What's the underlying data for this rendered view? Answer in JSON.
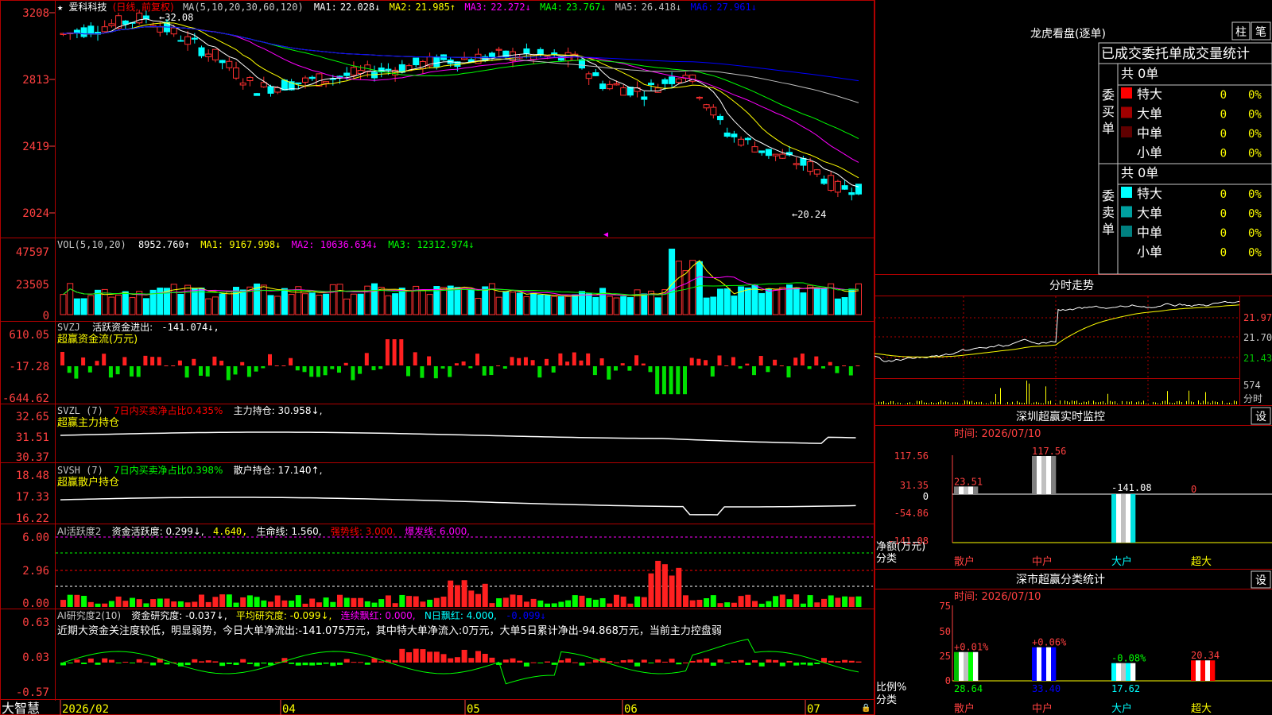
{
  "chart_header": {
    "star": "★",
    "stock_name": "爱科科技",
    "period": "(日线, 前复权)",
    "ma_params": "MA(5,10,20,30,60,120)",
    "ma_values": [
      {
        "label": "MA1:",
        "value": "22.028↓",
        "color": "#ffffff"
      },
      {
        "label": "MA2:",
        "value": "21.985↑",
        "color": "#ffff00"
      },
      {
        "label": "MA3:",
        "value": "22.272↓",
        "color": "#ff00ff"
      },
      {
        "label": "MA4:",
        "value": "23.767↓",
        "color": "#00ff00"
      },
      {
        "label": "MA5:",
        "value": "26.418↓",
        "color": "#c0c0c0"
      },
      {
        "label": "MA6:",
        "value": "27.961↓",
        "color": "#0000ff"
      }
    ],
    "high_label": "32.08",
    "low_label": "20.24"
  },
  "price_axis": [
    "3208",
    "2813",
    "2419",
    "2024"
  ],
  "vol_panel": {
    "title": "VOL(5,10,20)",
    "value": "8952.760↑",
    "ma1": "MA1: 9167.998↓",
    "ma2": "MA2: 10636.634↓",
    "ma3": "MA3: 12312.974↓",
    "axis": [
      "47597",
      "23505",
      "0"
    ]
  },
  "svzj_panel": {
    "title": "SVZJ",
    "label": "活跃资金进出:",
    "value": "-141.074↓,",
    "subtitle": "超赢资金流(万元)",
    "axis": [
      "610.05",
      "-17.28",
      "-644.62"
    ]
  },
  "svzl_panel": {
    "title": "SVZL (7)",
    "ratio": "7日内买卖净占比0.435%",
    "holding": "主力持仓: 30.958↓,",
    "subtitle": "超赢主力持仓",
    "axis": [
      "32.65",
      "31.51",
      "30.37"
    ]
  },
  "svsh_panel": {
    "title": "SVSH (7)",
    "ratio": "7日内买卖净占比0.398%",
    "holding": "散户持仓: 17.140↑,",
    "subtitle": "超赢散户持仓",
    "axis": [
      "18.48",
      "17.33",
      "16.22"
    ]
  },
  "ai_active_panel": {
    "title": "AI活跃度2",
    "label": "资金活跃度: 0.299↓,",
    "v2": "4.640,",
    "life": "生命线: 1.560,",
    "strong": "强势线: 3.000,",
    "burst": "爆发线: 6.000,",
    "axis": [
      "6.00",
      "2.96",
      "0.00"
    ]
  },
  "ai_research_panel": {
    "title": "AI研究度2(10)",
    "label": "资金研究度: -0.037↓,",
    "avg": "平均研究度: -0.099↓,",
    "streak": "连续飘红: 0.000,",
    "nday": "N日飘红: 4.000,",
    "last": "-0.099↓",
    "comment": "近期大资金关注度较低，明显弱势，今日大单净流出:-141.075万元，其中特大单净流入:0万元，大单5日累计净出-94.868万元，当前主力控盘弱",
    "axis": [
      "0.63",
      "0.03",
      "-0.57"
    ]
  },
  "bottom_bar": {
    "brand": "大智慧",
    "dates": [
      "2026/02",
      "04",
      "05",
      "06",
      "07"
    ]
  },
  "longhu": {
    "title": "龙虎看盘(逐单)",
    "tab_bar": "柱",
    "tab_pen": "笔",
    "header": "已成交委托单成交量统计",
    "buy_side": "委买单",
    "sell_side": "委卖单",
    "buy_total": "共 0单",
    "sell_total": "共 0单",
    "buy_rows": [
      {
        "label": "特大",
        "v": "0",
        "p": "0%",
        "color": "#ff0000"
      },
      {
        "label": "大单",
        "v": "0",
        "p": "0%",
        "color": "#a00000"
      },
      {
        "label": "中单",
        "v": "0",
        "p": "0%",
        "color": "#600000"
      },
      {
        "label": "小单",
        "v": "0",
        "p": "0%",
        "color": ""
      }
    ],
    "sell_rows": [
      {
        "label": "特大",
        "v": "0",
        "p": "0%",
        "color": "#00ffff"
      },
      {
        "label": "大单",
        "v": "0",
        "p": "0%",
        "color": "#00a0a0"
      },
      {
        "label": "中单",
        "v": "0",
        "p": "0%",
        "color": "#008080"
      },
      {
        "label": "小单",
        "v": "0",
        "p": "0%",
        "color": ""
      }
    ]
  },
  "intraday": {
    "title": "分时走势",
    "axis": [
      "21.97",
      "21.70",
      "21.43"
    ],
    "vol_label": "574",
    "vol_unit": "分时"
  },
  "monitor": {
    "title": "深圳超赢实时监控",
    "settings": "设",
    "time": "时间: 2026/07/10",
    "axis": [
      "117.56",
      "31.35",
      "0",
      "-54.86",
      "-141.08"
    ],
    "unit1": "净额(万元)",
    "unit2": "分类",
    "categories": [
      "散户",
      "中户",
      "大户",
      "超大"
    ],
    "values": [
      23.51,
      117.56,
      -141.08,
      0
    ],
    "value_labels": [
      "23.51",
      "117.56",
      "-141.08",
      "0"
    ]
  },
  "classify": {
    "title": "深市超赢分类统计",
    "settings": "设",
    "time": "时间: 2026/07/10",
    "axis": [
      "75",
      "50",
      "25",
      "0"
    ],
    "unit1": "比例%",
    "unit2": "分类",
    "categories": [
      "散户",
      "中户",
      "大户",
      "超大"
    ],
    "values": [
      28.64,
      33.4,
      17.62,
      20.34
    ],
    "changes": [
      "+0.01%",
      "+0.06%",
      "-0.08%",
      ""
    ],
    "value_labels": [
      "28.64",
      "33.40",
      "17.62",
      "20.34"
    ]
  },
  "chart_data": [
    {
      "type": "bar",
      "title": "深圳超赢实时监控",
      "categories": [
        "散户",
        "中户",
        "大户",
        "超大"
      ],
      "values": [
        23.51,
        117.56,
        -141.08,
        0
      ],
      "ylabel": "净额(万元)",
      "ylim": [
        -141.08,
        117.56
      ]
    },
    {
      "type": "bar",
      "title": "深市超赢分类统计",
      "categories": [
        "散户",
        "中户",
        "大户",
        "超大"
      ],
      "values": [
        28.64,
        33.4,
        17.62,
        20.34
      ],
      "ylabel": "比例%",
      "ylim": [
        0,
        75
      ]
    }
  ]
}
